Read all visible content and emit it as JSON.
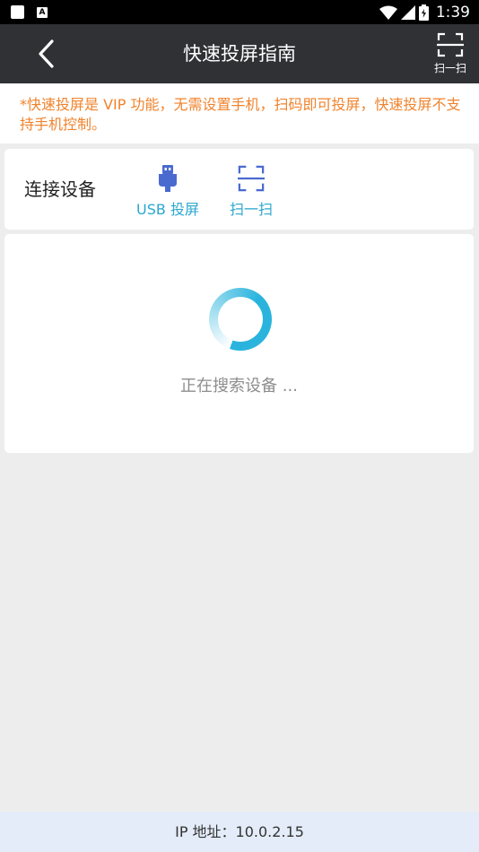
{
  "status_bar": {
    "time": "1:39",
    "icons": [
      "notification-square-icon",
      "a-icon",
      "wifi-icon",
      "signal-icon",
      "battery-icon"
    ]
  },
  "app_bar": {
    "title": "快速投屏指南",
    "back_icon": "chevron-left-icon",
    "scan_label": "扫一扫"
  },
  "notice": {
    "text": "*快速投屏是 VIP 功能，无需设置手机，扫码即可投屏，快速投屏不支持手机控制。",
    "color": "#f0832c"
  },
  "connect": {
    "label": "连接设备",
    "options": [
      {
        "label": "USB 投屏",
        "icon": "usb-icon"
      },
      {
        "label": "扫一扫",
        "icon": "scan-icon"
      }
    ],
    "accent": "#2aa7cf"
  },
  "search": {
    "status_text": "正在搜索设备 ..."
  },
  "footer": {
    "ip_text": "IP 地址：10.0.2.15"
  }
}
